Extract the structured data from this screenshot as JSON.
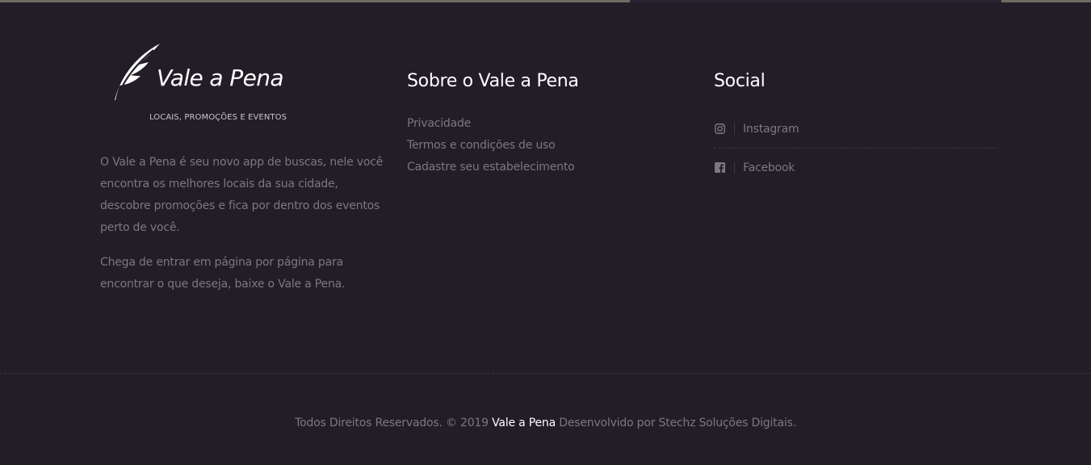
{
  "brand": {
    "name": "Vale a Pena",
    "tagline": "LOCAIS, PROMOÇÕES E EVENTOS",
    "about": [
      "O Vale a Pena é seu novo app de buscas, nele você encontra os melhores locais da sua cidade, descobre promoções e fica por dentro dos eventos perto de você.",
      "Chega de entrar em página por página para encontrar o que deseja, baixe o Vale a Pena."
    ]
  },
  "about_section": {
    "title": "Sobre o Vale a Pena",
    "links": [
      "Privacidade",
      "Termos e condições de uso",
      "Cadastre seu estabelecimento"
    ]
  },
  "social_section": {
    "title": "Social",
    "items": [
      {
        "label": "Instagram",
        "icon": "instagram-icon"
      },
      {
        "label": "Facebook",
        "icon": "facebook-icon"
      }
    ]
  },
  "footer": {
    "prefix": "Todos Direitos Reservados. © 2019",
    "brand": "Vale a Pena",
    "suffix": "Desenvolvido por Stechz Soluções Digitais."
  },
  "colors": {
    "background": "#221d27",
    "text_muted": "#7c7882",
    "text_light": "#ffffff"
  }
}
